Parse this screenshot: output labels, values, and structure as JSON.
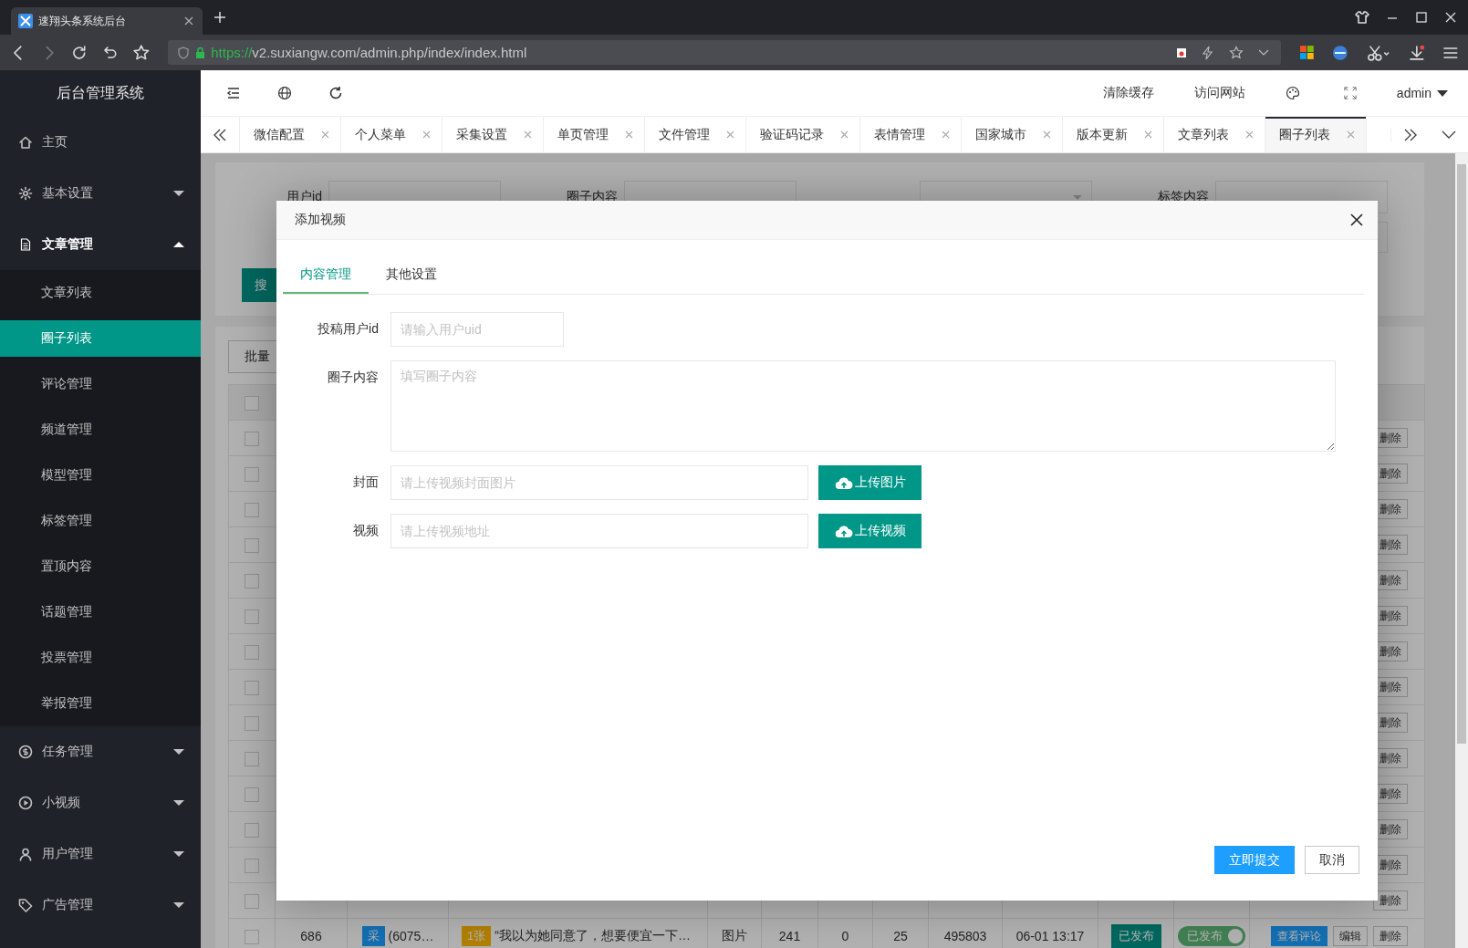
{
  "browser": {
    "tab_title": "速翔头条系统后台",
    "url_scheme": "https://",
    "url_rest": "v2.suxiangw.com/admin.php/index/index.html"
  },
  "sidebar": {
    "title": "后台管理系统",
    "items": [
      {
        "label": "主页",
        "kind": "link"
      },
      {
        "label": "基本设置",
        "kind": "group",
        "expanded": false
      },
      {
        "label": "文章管理",
        "kind": "group",
        "expanded": true,
        "children": [
          {
            "label": "文章列表",
            "selected": false
          },
          {
            "label": "圈子列表",
            "selected": true
          },
          {
            "label": "评论管理",
            "selected": false
          },
          {
            "label": "频道管理",
            "selected": false
          },
          {
            "label": "模型管理",
            "selected": false
          },
          {
            "label": "标签管理",
            "selected": false
          },
          {
            "label": "置顶内容",
            "selected": false
          },
          {
            "label": "话题管理",
            "selected": false
          },
          {
            "label": "投票管理",
            "selected": false
          },
          {
            "label": "举报管理",
            "selected": false
          }
        ]
      },
      {
        "label": "任务管理",
        "kind": "group",
        "expanded": false
      },
      {
        "label": "小视频",
        "kind": "group",
        "expanded": false
      },
      {
        "label": "用户管理",
        "kind": "group",
        "expanded": false
      },
      {
        "label": "广告管理",
        "kind": "group",
        "expanded": false
      }
    ]
  },
  "header": {
    "actions": [
      "清除缓存",
      "访问网站"
    ],
    "user": "admin"
  },
  "tabs": [
    {
      "label": "微信配置",
      "selected": false
    },
    {
      "label": "个人菜单",
      "selected": false
    },
    {
      "label": "采集设置",
      "selected": false
    },
    {
      "label": "单页管理",
      "selected": false
    },
    {
      "label": "文件管理",
      "selected": false
    },
    {
      "label": "验证码记录",
      "selected": false
    },
    {
      "label": "表情管理",
      "selected": false
    },
    {
      "label": "国家城市",
      "selected": false
    },
    {
      "label": "版本更新",
      "selected": false
    },
    {
      "label": "文章列表",
      "selected": false
    },
    {
      "label": "圈子列表",
      "selected": true
    }
  ],
  "filters": [
    {
      "label": "用户id",
      "kind": "input"
    },
    {
      "label": "圈子内容",
      "kind": "input"
    },
    {
      "kind": "select"
    },
    {
      "label": "标签内容",
      "kind": "input"
    }
  ],
  "search_button": "搜",
  "batch_button": "批量",
  "table": {
    "header_checked": false,
    "hidden_rows": [
      {
        "checked": false,
        "delete": "删除"
      },
      {
        "checked": false,
        "delete": "删除"
      },
      {
        "checked": false,
        "delete": "删除"
      },
      {
        "checked": false,
        "delete": "删除"
      },
      {
        "checked": false,
        "delete": "删除"
      },
      {
        "checked": false,
        "delete": "删除"
      },
      {
        "checked": false,
        "delete": "删除"
      },
      {
        "checked": false,
        "delete": "删除"
      },
      {
        "checked": false,
        "delete": "删除"
      },
      {
        "checked": false,
        "delete": "删除"
      },
      {
        "checked": false,
        "delete": "删除"
      },
      {
        "checked": false,
        "delete": "删除"
      },
      {
        "checked": false,
        "delete": "删除"
      },
      {
        "checked": false,
        "delete": "删除"
      }
    ],
    "rows": [
      {
        "checked": false,
        "id": "686",
        "source_tag": "采",
        "ref": "(6075…",
        "count_tag": "1张",
        "content": "“我以为她同意了，想要便宜一下…",
        "type": "图片",
        "column_6": "241",
        "column_7": "0",
        "column_8": "25",
        "column_9": "495803",
        "time": "06-01 13:17",
        "status": "已发布",
        "published": true,
        "switch_label": "已发布",
        "comments": "查看评论",
        "edit": "编辑",
        "delete": "删除"
      }
    ]
  },
  "dialog": {
    "title": "添加视频",
    "tabs": [
      {
        "label": "内容管理",
        "selected": true
      },
      {
        "label": "其他设置",
        "selected": false
      }
    ],
    "fields": [
      {
        "label": "投稿用户id",
        "kind": "input",
        "placeholder": "请输入用户uid"
      },
      {
        "label": "圈子内容",
        "kind": "textarea",
        "placeholder": "填写圈子内容"
      },
      {
        "label": "封面",
        "kind": "upload",
        "placeholder": "请上传视频封面图片",
        "button": "上传图片"
      },
      {
        "label": "视频",
        "kind": "upload",
        "placeholder": "请上传视频地址",
        "button": "上传视频"
      }
    ],
    "submit": "立即提交",
    "cancel": "取消"
  }
}
